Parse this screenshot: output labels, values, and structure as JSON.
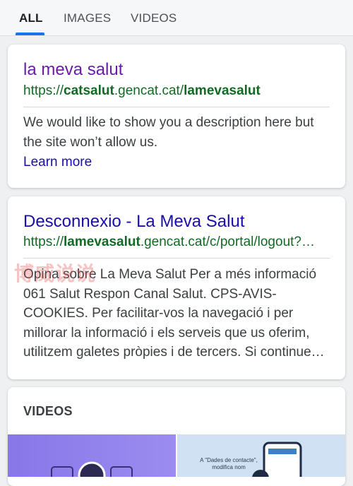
{
  "tabs": [
    {
      "label": "ALL",
      "active": true
    },
    {
      "label": "IMAGES",
      "active": false
    },
    {
      "label": "VIDEOS",
      "active": false
    }
  ],
  "accent_color": "#1a73e8",
  "results": [
    {
      "title": "la meva salut",
      "title_color": "#681da8",
      "url_prefix": "https://",
      "url_bold1": "catsalut",
      "url_mid": ".gencat.cat/",
      "url_bold2": "lamevasalut",
      "url_suffix": "",
      "snippet": "We would like to show you a description here but the site won’t allow us.",
      "learn_more": "Learn more"
    },
    {
      "title": "Desconnexio - La Meva Salut",
      "title_color": "#1a0dab",
      "url_prefix": "https://",
      "url_bold1": "lamevasalut",
      "url_mid": ".gencat.cat/c/portal/logout?…",
      "url_bold2": "",
      "url_suffix": "",
      "snippet": "Opina sobre La Meva Salut Per a més informació 061 Salut Respon Canal Salut. CPS-AVIS-COOKIES. Per facilitar-vos la navegació i per millorar la informació i els serveis que us oferim, utilitzem galetes pròpies i de tercers. Si continue…"
    }
  ],
  "videos_section": {
    "header": "VIDEOS",
    "thumb2_caption": "A \"Dades de contacte\", modifica nom"
  },
  "watermark": "博威说说"
}
